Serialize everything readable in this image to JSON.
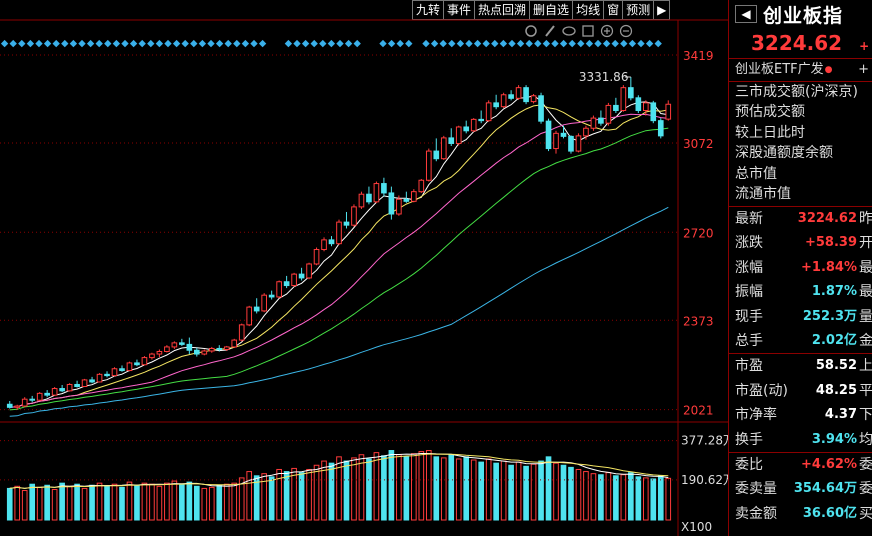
{
  "toolbar": {
    "buttons": [
      "九转",
      "事件",
      "热点回溯",
      "删自选",
      "均线",
      "窗",
      "预测"
    ],
    "nav_arrow": "▶"
  },
  "chart_data": {
    "type": "candlestick",
    "price_axis": {
      "ticks": [
        3419,
        3072,
        2720,
        2373,
        2021
      ],
      "ylim": [
        1980,
        3470
      ]
    },
    "volume_axis": {
      "ticks": [
        "377.28万",
        "190.62万"
      ],
      "unit_label": "X100"
    },
    "high_annotation": "3331.86",
    "toolbar_icons": [
      "gear-icon",
      "brush-icon",
      "eye-icon",
      "square-icon",
      "plus-icon",
      "minus-icon"
    ],
    "candles": [
      [
        2042,
        2055,
        2025,
        2030
      ],
      [
        2030,
        2040,
        2020,
        2035
      ],
      [
        2035,
        2070,
        2030,
        2062
      ],
      [
        2062,
        2075,
        2050,
        2058
      ],
      [
        2058,
        2090,
        2055,
        2085
      ],
      [
        2085,
        2098,
        2070,
        2078
      ],
      [
        2078,
        2110,
        2075,
        2104
      ],
      [
        2104,
        2118,
        2090,
        2095
      ],
      [
        2095,
        2125,
        2092,
        2120
      ],
      [
        2120,
        2135,
        2108,
        2112
      ],
      [
        2112,
        2142,
        2110,
        2138
      ],
      [
        2138,
        2150,
        2125,
        2130
      ],
      [
        2130,
        2165,
        2128,
        2160
      ],
      [
        2160,
        2172,
        2148,
        2155
      ],
      [
        2155,
        2188,
        2152,
        2182
      ],
      [
        2182,
        2195,
        2170,
        2175
      ],
      [
        2175,
        2210,
        2172,
        2205
      ],
      [
        2205,
        2218,
        2192,
        2198
      ],
      [
        2198,
        2232,
        2195,
        2226
      ],
      [
        2226,
        2245,
        2218,
        2240
      ],
      [
        2240,
        2258,
        2228,
        2250
      ],
      [
        2250,
        2275,
        2246,
        2268
      ],
      [
        2268,
        2290,
        2260,
        2284
      ],
      [
        2284,
        2300,
        2272,
        2278
      ],
      [
        2278,
        2305,
        2240,
        2255
      ],
      [
        2255,
        2265,
        2230,
        2240
      ],
      [
        2240,
        2258,
        2235,
        2252
      ],
      [
        2252,
        2268,
        2245,
        2262
      ],
      [
        2262,
        2275,
        2250,
        2258
      ],
      [
        2258,
        2272,
        2252,
        2268
      ],
      [
        2268,
        2300,
        2264,
        2295
      ],
      [
        2295,
        2360,
        2290,
        2355
      ],
      [
        2355,
        2430,
        2350,
        2425
      ],
      [
        2425,
        2460,
        2400,
        2410
      ],
      [
        2410,
        2480,
        2405,
        2472
      ],
      [
        2472,
        2490,
        2455,
        2465
      ],
      [
        2465,
        2530,
        2460,
        2525
      ],
      [
        2525,
        2548,
        2500,
        2510
      ],
      [
        2510,
        2560,
        2505,
        2555
      ],
      [
        2555,
        2580,
        2530,
        2540
      ],
      [
        2540,
        2600,
        2535,
        2595
      ],
      [
        2595,
        2660,
        2590,
        2652
      ],
      [
        2652,
        2700,
        2645,
        2690
      ],
      [
        2690,
        2705,
        2665,
        2675
      ],
      [
        2675,
        2770,
        2670,
        2760
      ],
      [
        2760,
        2800,
        2735,
        2748
      ],
      [
        2748,
        2830,
        2742,
        2820
      ],
      [
        2820,
        2880,
        2812,
        2870
      ],
      [
        2870,
        2900,
        2830,
        2840
      ],
      [
        2840,
        2920,
        2835,
        2912
      ],
      [
        2912,
        2935,
        2860,
        2875
      ],
      [
        2875,
        2900,
        2770,
        2792
      ],
      [
        2792,
        2865,
        2785,
        2850
      ],
      [
        2850,
        2880,
        2836,
        2842
      ],
      [
        2842,
        2890,
        2838,
        2880
      ],
      [
        2880,
        2930,
        2875,
        2925
      ],
      [
        2925,
        3050,
        2920,
        3040
      ],
      [
        3040,
        3090,
        3000,
        3010
      ],
      [
        3010,
        3100,
        3005,
        3092
      ],
      [
        3092,
        3130,
        3060,
        3070
      ],
      [
        3070,
        3140,
        3062,
        3135
      ],
      [
        3135,
        3160,
        3110,
        3120
      ],
      [
        3120,
        3170,
        3115,
        3165
      ],
      [
        3165,
        3200,
        3150,
        3160
      ],
      [
        3160,
        3240,
        3155,
        3230
      ],
      [
        3230,
        3262,
        3205,
        3215
      ],
      [
        3215,
        3270,
        3210,
        3262
      ],
      [
        3262,
        3280,
        3240,
        3248
      ],
      [
        3248,
        3300,
        3242,
        3290
      ],
      [
        3290,
        3300,
        3225,
        3235
      ],
      [
        3235,
        3265,
        3228,
        3258
      ],
      [
        3258,
        3270,
        3148,
        3158
      ],
      [
        3158,
        3168,
        3040,
        3050
      ],
      [
        3050,
        3120,
        3030,
        3110
      ],
      [
        3110,
        3140,
        3090,
        3098
      ],
      [
        3098,
        3102,
        3030,
        3040
      ],
      [
        3040,
        3110,
        3035,
        3100
      ],
      [
        3100,
        3140,
        3085,
        3130
      ],
      [
        3130,
        3180,
        3120,
        3170
      ],
      [
        3170,
        3200,
        3140,
        3150
      ],
      [
        3150,
        3230,
        3140,
        3220
      ],
      [
        3220,
        3250,
        3190,
        3200
      ],
      [
        3200,
        3300,
        3195,
        3290
      ],
      [
        3290,
        3332,
        3240,
        3250
      ],
      [
        3250,
        3260,
        3190,
        3200
      ],
      [
        3200,
        3240,
        3180,
        3230
      ],
      [
        3230,
        3238,
        3150,
        3160
      ],
      [
        3160,
        3170,
        3090,
        3100
      ],
      [
        3166,
        3240,
        3160,
        3224.62
      ]
    ],
    "volumes": [
      150,
      160,
      140,
      170,
      155,
      165,
      145,
      175,
      160,
      170,
      150,
      165,
      175,
      160,
      170,
      155,
      180,
      165,
      175,
      170,
      160,
      175,
      185,
      170,
      180,
      160,
      150,
      155,
      165,
      170,
      175,
      200,
      230,
      210,
      220,
      205,
      240,
      230,
      245,
      225,
      240,
      260,
      280,
      270,
      300,
      280,
      295,
      310,
      290,
      320,
      305,
      330,
      310,
      300,
      315,
      325,
      330,
      300,
      295,
      310,
      290,
      300,
      285,
      275,
      290,
      270,
      280,
      260,
      275,
      255,
      265,
      280,
      300,
      270,
      260,
      250,
      240,
      230,
      220,
      215,
      225,
      210,
      215,
      225,
      205,
      200,
      195,
      210,
      198
    ]
  },
  "right_panel": {
    "index_name": "创业板指",
    "arrow": "◀",
    "price": "3224.62",
    "price_tail": "+",
    "etf_label": "创业板ETF广发",
    "etf_dot": "●",
    "etf_tail": "+",
    "info_labels": [
      "三市成交额(沪深京)",
      "预估成交额",
      "较上日此时",
      "深股通额度余额",
      "总市值",
      "流通市值"
    ],
    "stats_a": [
      {
        "k": "最新",
        "v": "3224.62",
        "t": "昨"
      },
      {
        "k": "涨跌",
        "v": "+58.39",
        "t": "开"
      },
      {
        "k": "涨幅",
        "v": "+1.84%",
        "t": "最"
      },
      {
        "k": "振幅",
        "v": "1.87%",
        "t": "最"
      },
      {
        "k": "现手",
        "v": "252.3万",
        "t": "量"
      },
      {
        "k": "总手",
        "v": "2.02亿",
        "t": "金"
      }
    ],
    "stats_b": [
      {
        "k": "市盈",
        "v": "58.52",
        "t": "上"
      },
      {
        "k": "市盈(动)",
        "v": "48.25",
        "t": "平"
      },
      {
        "k": "市净率",
        "v": "4.37",
        "t": "下"
      },
      {
        "k": "换手",
        "v": "3.94%",
        "t": "均"
      }
    ],
    "stats_c": [
      {
        "k": "委比",
        "v": "+4.62%",
        "t": "委"
      },
      {
        "k": "委卖量",
        "v": "354.64万",
        "t": "委"
      },
      {
        "k": "卖金额",
        "v": "36.60亿",
        "t": "买"
      }
    ],
    "colors": {
      "up": "#ff3b3b",
      "down": "#4fe3ef",
      "neutral": "#ffffff"
    }
  }
}
